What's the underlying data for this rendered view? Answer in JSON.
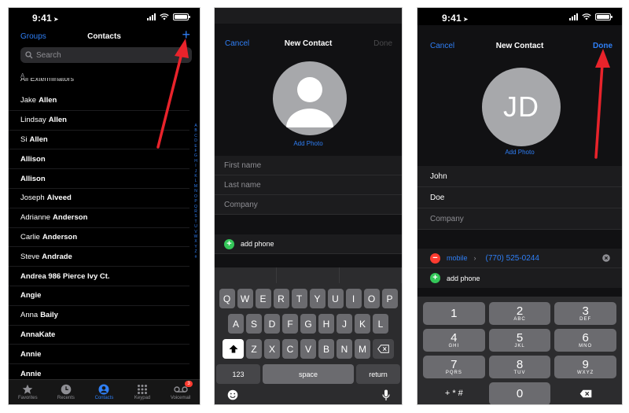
{
  "status_time": "9:41",
  "accent": "#2f7ff6",
  "screen1": {
    "nav_left": "Groups",
    "title": "Contacts",
    "add_label": "+",
    "search_placeholder": "Search",
    "section": "A",
    "clipped_row": "All Exterminators",
    "contacts": [
      {
        "first": "Jake",
        "last": "Allen"
      },
      {
        "first": "Lindsay",
        "last": "Allen"
      },
      {
        "first": "Si",
        "last": "Allen"
      },
      {
        "first": "",
        "last": "Allison"
      },
      {
        "first": "",
        "last": "Allison"
      },
      {
        "first": "Joseph",
        "last": "Alveed"
      },
      {
        "first": "Adrianne",
        "last": "Anderson"
      },
      {
        "first": "Carlie",
        "last": "Anderson"
      },
      {
        "first": "Steve",
        "last": "Andrade"
      },
      {
        "first": "",
        "last": "Andrea 986 Pierce Ivy Ct."
      },
      {
        "first": "",
        "last": "Angie"
      },
      {
        "first": "Anna",
        "last": "Baily"
      },
      {
        "first": "",
        "last": "AnnaKate"
      },
      {
        "first": "",
        "last": "Annie"
      },
      {
        "first": "",
        "last": "Annie"
      }
    ],
    "index_letters": [
      "A",
      "B",
      "C",
      "D",
      "E",
      "F",
      "G",
      "H",
      "I",
      "J",
      "K",
      "L",
      "M",
      "N",
      "O",
      "P",
      "Q",
      "R",
      "S",
      "T",
      "U",
      "V",
      "W",
      "X",
      "Y",
      "Z",
      "#"
    ],
    "tabs": [
      {
        "label": "Favorites",
        "icon": "star-icon"
      },
      {
        "label": "Recents",
        "icon": "clock-icon"
      },
      {
        "label": "Contacts",
        "icon": "person-circle-icon"
      },
      {
        "label": "Keypad",
        "icon": "keypad-icon"
      },
      {
        "label": "Voicemail",
        "icon": "voicemail-icon",
        "badge": "3"
      }
    ],
    "active_tab": 2
  },
  "screen2": {
    "cancel": "Cancel",
    "title": "New Contact",
    "done": "Done",
    "add_photo": "Add Photo",
    "first_name_placeholder": "First name",
    "last_name_placeholder": "Last name",
    "company_placeholder": "Company",
    "add_phone": "add phone",
    "keys_row1": [
      "Q",
      "W",
      "E",
      "R",
      "T",
      "Y",
      "U",
      "I",
      "O",
      "P"
    ],
    "keys_row2": [
      "A",
      "S",
      "D",
      "F",
      "G",
      "H",
      "J",
      "K",
      "L"
    ],
    "keys_row3": [
      "Z",
      "X",
      "C",
      "V",
      "B",
      "N",
      "M"
    ],
    "key_123": "123",
    "key_space": "space",
    "key_return": "return"
  },
  "screen3": {
    "cancel": "Cancel",
    "title": "New Contact",
    "done": "Done",
    "initials": "JD",
    "add_photo": "Add Photo",
    "first_name": "John",
    "last_name": "Doe",
    "company_placeholder": "Company",
    "phone_label": "mobile",
    "phone_value": "(770) 525-0244",
    "add_phone": "add phone",
    "keypad": [
      [
        {
          "d": "1",
          "l": ""
        },
        {
          "d": "2",
          "l": "ABC"
        },
        {
          "d": "3",
          "l": "DEF"
        }
      ],
      [
        {
          "d": "4",
          "l": "GHI"
        },
        {
          "d": "5",
          "l": "JKL"
        },
        {
          "d": "6",
          "l": "MNO"
        }
      ],
      [
        {
          "d": "7",
          "l": "PQRS"
        },
        {
          "d": "8",
          "l": "TUV"
        },
        {
          "d": "9",
          "l": "WXYZ"
        }
      ]
    ],
    "key_symbols": "+ * #",
    "key_zero": "0"
  },
  "annotation_color": "#e8232b"
}
